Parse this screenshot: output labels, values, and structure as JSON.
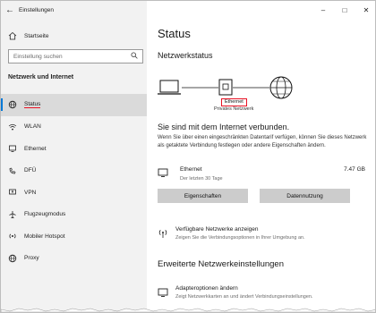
{
  "window": {
    "app_title": "Einstellungen"
  },
  "sidebar": {
    "home_label": "Startseite",
    "search_placeholder": "Einstellung suchen",
    "section_title": "Netzwerk und Internet",
    "items": [
      {
        "label": "Status",
        "icon": "globe-status-icon",
        "active": true
      },
      {
        "label": "WLAN",
        "icon": "wifi-icon"
      },
      {
        "label": "Ethernet",
        "icon": "ethernet-icon"
      },
      {
        "label": "DFÜ",
        "icon": "dialup-icon"
      },
      {
        "label": "VPN",
        "icon": "vpn-icon"
      },
      {
        "label": "Flugzeugmodus",
        "icon": "airplane-icon"
      },
      {
        "label": "Mobiler Hotspot",
        "icon": "hotspot-icon"
      },
      {
        "label": "Proxy",
        "icon": "globe-icon"
      }
    ]
  },
  "main": {
    "title": "Status",
    "network_status_title": "Netzwerkstatus",
    "diagram": {
      "adapter_label": "Ethernet",
      "network_label": "Privates Netzwerk"
    },
    "connected_text": "Sie sind mit dem Internet verbunden.",
    "description": "Wenn Sie über einen eingeschränkten Datentarif verfügen, können Sie dieses Netzwerk als getaktete Verbindung festlegen oder andere Eigenschaften ändern.",
    "connection": {
      "name": "Ethernet",
      "period": "Der letzten 30 Tage",
      "usage": "7.47 GB"
    },
    "buttons": {
      "properties": "Eigenschaften",
      "data_usage": "Datennutzung"
    },
    "available_networks": {
      "title": "Verfügbare Netzwerke anzeigen",
      "subtitle": "Zeigen Sie die Verbindungsoptionen in Ihrer Umgebung an."
    },
    "advanced_title": "Erweiterte Netzwerkeinstellungen",
    "adapter_options": {
      "title": "Adapteroptionen ändern",
      "subtitle": "Zeigt Netzwerkkarten an und ändert Verbindungseinstellungen."
    }
  },
  "colors": {
    "accent": "#0078d7",
    "highlight": "#e81123",
    "sidebar_bg": "#f2f2f2",
    "button_bg": "#cccccc"
  }
}
